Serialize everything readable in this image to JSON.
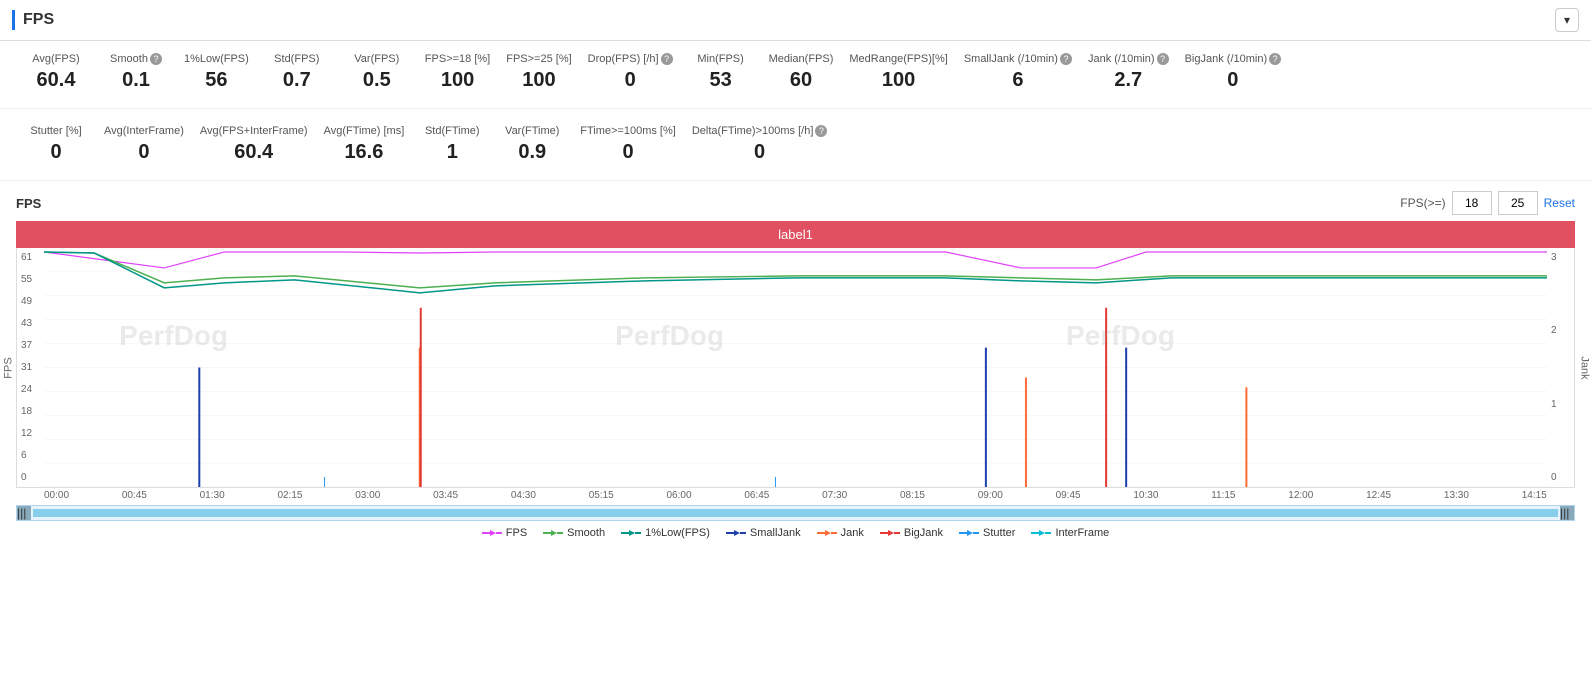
{
  "header": {
    "title": "FPS",
    "chevron": "▾"
  },
  "stats_row1": [
    {
      "label": "Avg(FPS)",
      "value": "60.4",
      "has_help": false
    },
    {
      "label": "Smooth",
      "value": "0.1",
      "has_help": true
    },
    {
      "label": "1%Low(FPS)",
      "value": "56",
      "has_help": false
    },
    {
      "label": "Std(FPS)",
      "value": "0.7",
      "has_help": false
    },
    {
      "label": "Var(FPS)",
      "value": "0.5",
      "has_help": false
    },
    {
      "label": "FPS>=18 [%]",
      "value": "100",
      "has_help": false
    },
    {
      "label": "FPS>=25 [%]",
      "value": "100",
      "has_help": false
    },
    {
      "label": "Drop(FPS) [/h]",
      "value": "0",
      "has_help": true
    },
    {
      "label": "Min(FPS)",
      "value": "53",
      "has_help": false
    },
    {
      "label": "Median(FPS)",
      "value": "60",
      "has_help": false
    },
    {
      "label": "MedRange(FPS)[%]",
      "value": "100",
      "has_help": false
    },
    {
      "label": "SmallJank (/10min)",
      "value": "6",
      "has_help": true
    },
    {
      "label": "Jank (/10min)",
      "value": "2.7",
      "has_help": true
    },
    {
      "label": "BigJank (/10min)",
      "value": "0",
      "has_help": true
    }
  ],
  "stats_row2": [
    {
      "label": "Stutter [%]",
      "value": "0",
      "has_help": false
    },
    {
      "label": "Avg(InterFrame)",
      "value": "0",
      "has_help": false
    },
    {
      "label": "Avg(FPS+InterFrame)",
      "value": "60.4",
      "has_help": false
    },
    {
      "label": "Avg(FTime) [ms]",
      "value": "16.6",
      "has_help": false
    },
    {
      "label": "Std(FTime)",
      "value": "1",
      "has_help": false
    },
    {
      "label": "Var(FTime)",
      "value": "0.9",
      "has_help": false
    },
    {
      "label": "FTime>=100ms [%]",
      "value": "0",
      "has_help": false
    },
    {
      "label": "Delta(FTime)>100ms [/h]",
      "value": "0",
      "has_help": true
    }
  ],
  "chart": {
    "title": "FPS",
    "fps_gte_label": "FPS(>=)",
    "fps_val1": "18",
    "fps_val2": "25",
    "reset_label": "Reset",
    "label_bar_text": "label1",
    "y_axis_left": [
      "61",
      "55",
      "49",
      "43",
      "37",
      "31",
      "24",
      "18",
      "12",
      "6",
      "0"
    ],
    "y_axis_right": [
      "3",
      "2",
      "1",
      "0"
    ],
    "x_axis_labels": [
      "00:00",
      "00:45",
      "01:30",
      "02:15",
      "03:00",
      "03:45",
      "04:30",
      "05:15",
      "06:00",
      "06:45",
      "07:30",
      "08:15",
      "09:00",
      "09:45",
      "10:30",
      "11:15",
      "12:00",
      "12:45",
      "13:30",
      "14:15"
    ],
    "jank_label": "Jank",
    "watermarks": [
      "PerfDog",
      "PerfDog",
      "PerfDog"
    ]
  },
  "legend": [
    {
      "label": "FPS",
      "color": "#e040fb",
      "style": "line"
    },
    {
      "label": "Smooth",
      "color": "#4caf50",
      "style": "line"
    },
    {
      "label": "1%Low(FPS)",
      "color": "#009688",
      "style": "line"
    },
    {
      "label": "SmallJank",
      "color": "#1e40af",
      "style": "line"
    },
    {
      "label": "Jank",
      "color": "#ff6b35",
      "style": "line"
    },
    {
      "label": "BigJank",
      "color": "#e53935",
      "style": "line"
    },
    {
      "label": "Stutter",
      "color": "#2196f3",
      "style": "line"
    },
    {
      "label": "InterFrame",
      "color": "#00bcd4",
      "style": "line"
    }
  ]
}
